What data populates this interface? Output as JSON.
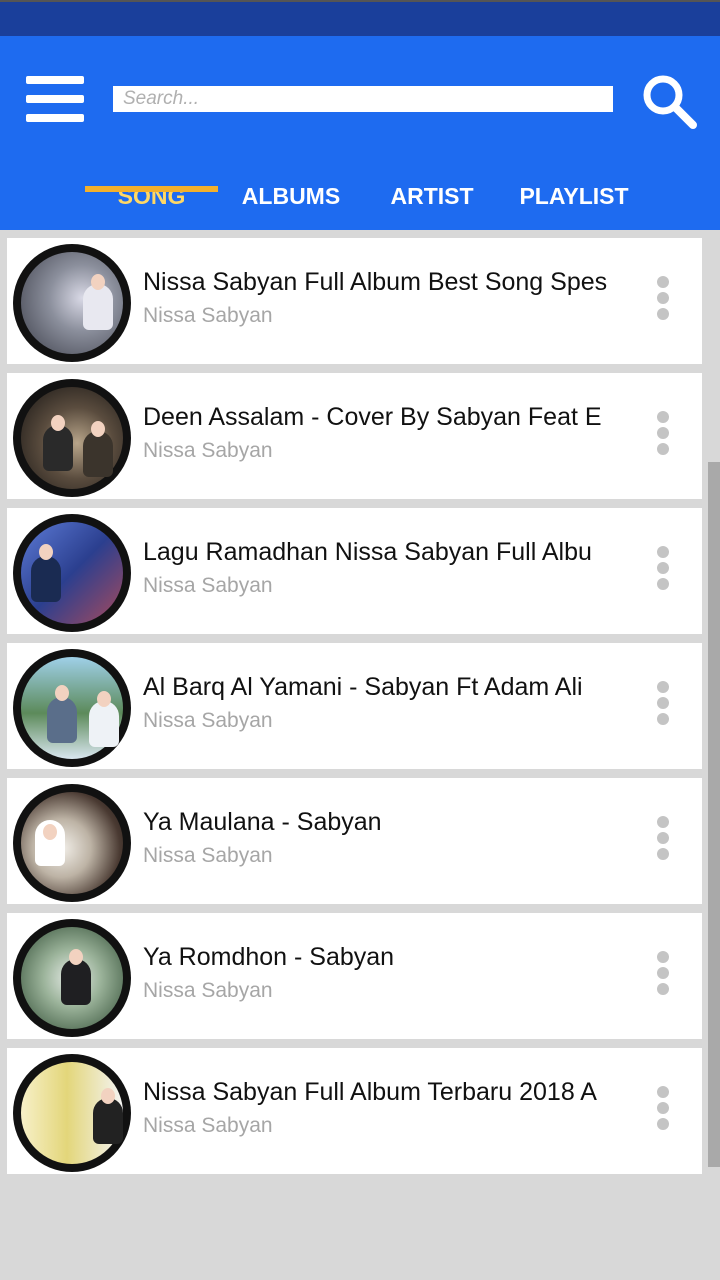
{
  "search": {
    "placeholder": "Search...",
    "value": ""
  },
  "tabs": [
    {
      "label": "SONG",
      "active": true
    },
    {
      "label": "ALBUMS",
      "active": false
    },
    {
      "label": "ARTIST",
      "active": false
    },
    {
      "label": "PLAYLIST",
      "active": false
    }
  ],
  "icons": {
    "menu": "hamburger-menu-icon",
    "search": "search-icon",
    "more": "more-vertical-icon"
  },
  "colors": {
    "status_bar": "#1a3f9b",
    "header": "#1e6bf0",
    "tab_indicator": "#f3b02c",
    "active_tab": "#ffd866",
    "artist_text": "#a6a6a6"
  },
  "songs": [
    {
      "title": "Nissa Sabyan Full Album Best Song Spes",
      "artist": "Nissa Sabyan"
    },
    {
      "title": "Deen Assalam - Cover By Sabyan Feat E",
      "artist": "Nissa Sabyan"
    },
    {
      "title": "Lagu Ramadhan Nissa Sabyan Full Albu",
      "artist": "Nissa Sabyan"
    },
    {
      "title": "Al Barq Al Yamani - Sabyan Ft Adam Ali",
      "artist": "Nissa Sabyan"
    },
    {
      "title": "Ya Maulana - Sabyan",
      "artist": "Nissa Sabyan"
    },
    {
      "title": "Ya Romdhon - Sabyan",
      "artist": "Nissa Sabyan"
    },
    {
      "title": "Nissa Sabyan Full Album Terbaru 2018 A",
      "artist": "Nissa Sabyan"
    }
  ]
}
